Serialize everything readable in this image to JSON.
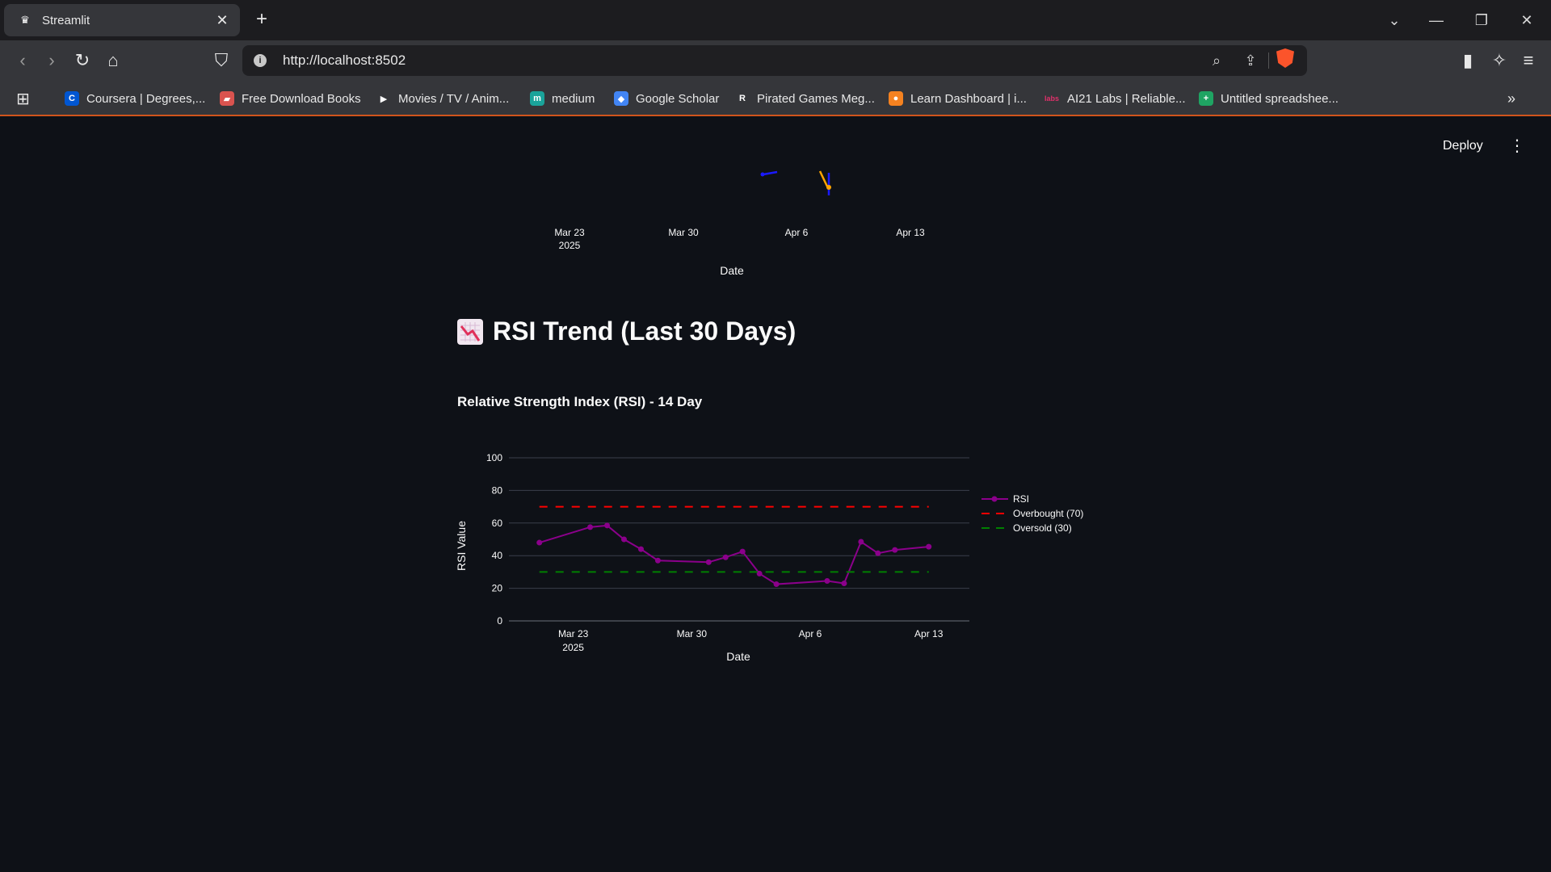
{
  "browser": {
    "tab_title": "Streamlit",
    "url": "http://localhost:8502",
    "bookmarks": [
      {
        "label": "Coursera | Degrees,...",
        "icon": "coursera-icon",
        "color": "#0056d2",
        "glyph": "C"
      },
      {
        "label": "Free Download Books",
        "icon": "book-icon",
        "color": "#d9534f",
        "glyph": "▰"
      },
      {
        "label": "Movies / TV / Anim...",
        "icon": "play-icon",
        "color": "transparent",
        "glyph": "▶"
      },
      {
        "label": "medium",
        "icon": "medium-icon",
        "color": "#1aa39a",
        "glyph": "m"
      },
      {
        "label": "Google Scholar",
        "icon": "scholar-icon",
        "color": "#4285f4",
        "glyph": "◆"
      },
      {
        "label": "Pirated Games Meg...",
        "icon": "r-icon",
        "color": "transparent",
        "glyph": "R"
      },
      {
        "label": "Learn Dashboard | i...",
        "icon": "learn-icon",
        "color": "#f58220",
        "glyph": "●"
      },
      {
        "label": "AI21 Labs | Reliable...",
        "icon": "labs-icon",
        "color": "transparent",
        "glyph": "labs"
      },
      {
        "label": "Untitled spreadshee...",
        "icon": "sheets-icon",
        "color": "#1fa463",
        "glyph": "+"
      }
    ]
  },
  "header": {
    "deploy_label": "Deploy"
  },
  "top_chart": {
    "tick_labels": [
      "Mar 23",
      "Mar 30",
      "Apr 6",
      "Apr 13"
    ],
    "year_label": "2025",
    "xlabel": "Date"
  },
  "section": {
    "title": "RSI Trend (Last 30 Days)",
    "emoji_icon": "chart-decreasing-icon"
  },
  "chart_data": {
    "type": "line",
    "title": "Relative Strength Index (RSI) - 14 Day",
    "xlabel": "Date",
    "ylabel": "RSI Value",
    "ylim": [
      0,
      100
    ],
    "yticks": [
      0,
      20,
      40,
      60,
      80,
      100
    ],
    "x_tick_labels": [
      "Mar 23",
      "Mar 30",
      "Apr 6",
      "Apr 13"
    ],
    "x_tick_days": [
      23,
      30,
      37,
      44
    ],
    "x_year_label": "2025",
    "x_range_days": [
      19.2,
      46.4
    ],
    "grid": true,
    "legend_position": "right",
    "series": [
      {
        "name": "RSI",
        "color": "#8b008b",
        "style": "line+markers",
        "x_days": [
          21,
          24,
          25,
          26,
          27,
          28,
          31,
          32,
          33,
          34,
          35,
          38,
          39,
          40,
          41,
          42,
          44
        ],
        "values": [
          48,
          57.5,
          58.5,
          50,
          44,
          37,
          36,
          39,
          42.5,
          29,
          22.5,
          24.5,
          23,
          48.5,
          41.5,
          43.5,
          45.5
        ]
      },
      {
        "name": "Overbought (70)",
        "color": "#ff0000",
        "style": "dash",
        "x_days": [
          21,
          44
        ],
        "values": [
          70,
          70
        ]
      },
      {
        "name": "Oversold (30)",
        "color": "#008000",
        "style": "dash",
        "x_days": [
          21,
          44
        ],
        "values": [
          30,
          30
        ]
      }
    ]
  }
}
